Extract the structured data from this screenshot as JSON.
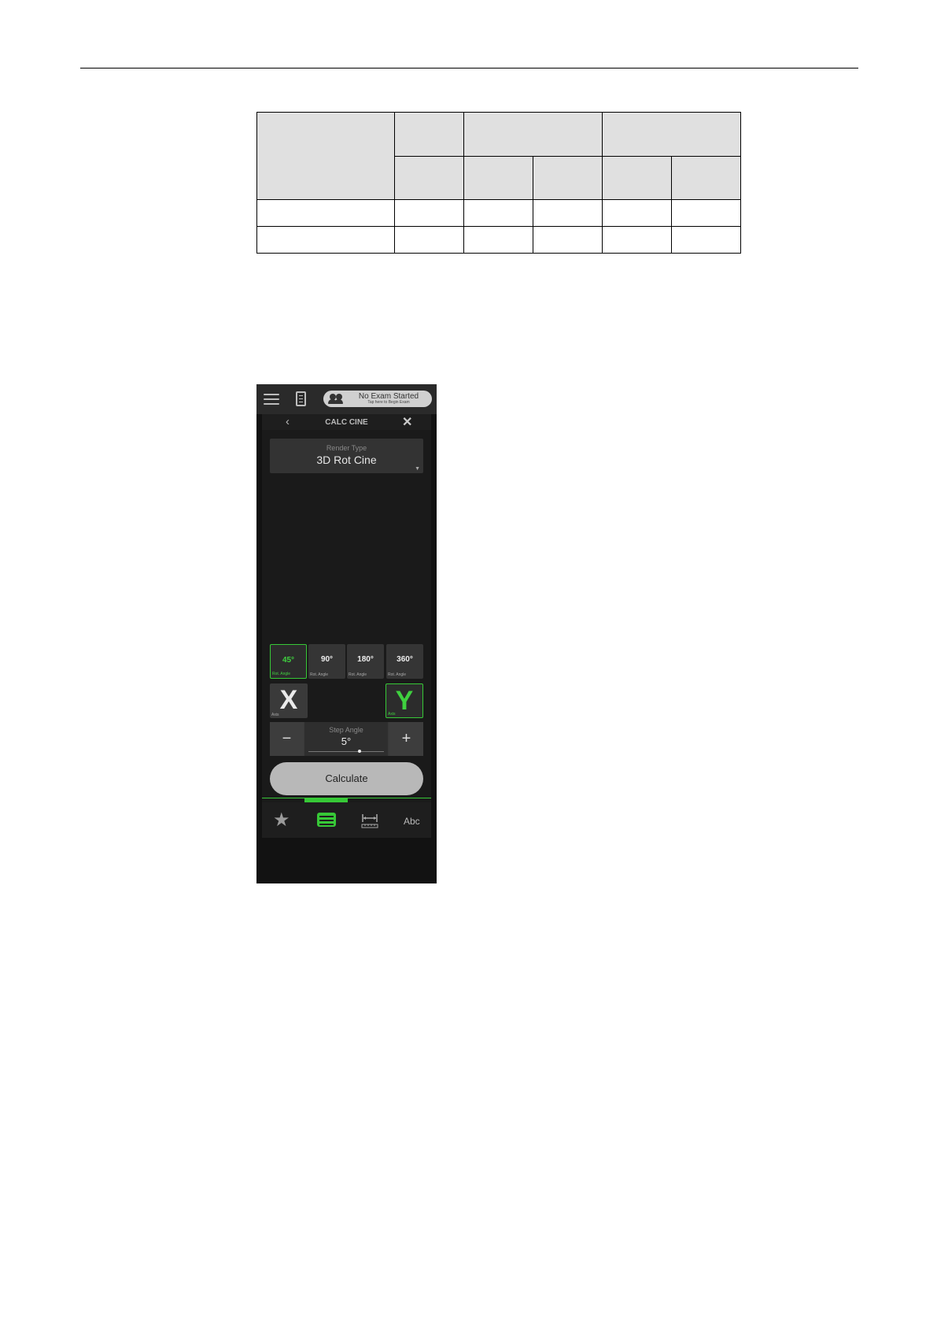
{
  "app": {
    "exam_title": "No Exam Started",
    "exam_subtitle": "Tap here to Begin Exam",
    "nav_title": "CALC CINE",
    "back_glyph": "‹",
    "close_glyph": "✕"
  },
  "render": {
    "label": "Render Type",
    "value": "3D Rot Cine"
  },
  "rotation_buttons": [
    {
      "value": "45°",
      "label": "Rot. Angle",
      "selected": true
    },
    {
      "value": "90°",
      "label": "Rot. Angle",
      "selected": false
    },
    {
      "value": "180°",
      "label": "Rot. Angle",
      "selected": false
    },
    {
      "value": "360°",
      "label": "Rot. Angle",
      "selected": false
    }
  ],
  "axis_buttons": [
    {
      "letter": "X",
      "label": "Axis",
      "selected": false
    },
    {
      "letter": "Y",
      "label": "Axis",
      "selected": true
    }
  ],
  "step": {
    "label": "Step Angle",
    "value": "5°",
    "minus": "−",
    "plus": "+"
  },
  "calculate_label": "Calculate",
  "bottom_tabs": {
    "text_tab": "Abc",
    "active": "presets"
  },
  "icons": [
    "menu-icon",
    "notes-icon",
    "people-icon",
    "chevron-left-icon",
    "close-icon",
    "star-icon",
    "preset-icon",
    "measure-icon"
  ],
  "colors": {
    "accent_green": "#37c837",
    "background_dark": "#121212",
    "table_header": "#e0e0e0"
  }
}
